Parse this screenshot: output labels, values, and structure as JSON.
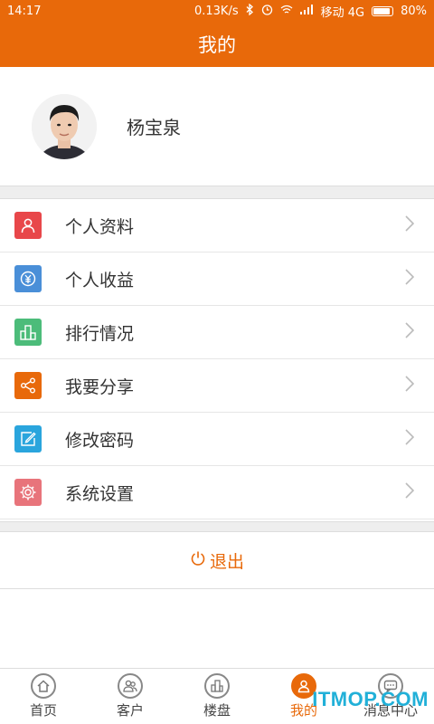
{
  "status": {
    "time": "14:17",
    "speed": "0.13K/s",
    "carrier": "移动 4G",
    "battery": "80%"
  },
  "header": {
    "title": "我的"
  },
  "profile": {
    "name": "杨宝泉"
  },
  "menu": {
    "items": [
      {
        "label": "个人资料",
        "icon": "person-icon",
        "color": "#e8474a"
      },
      {
        "label": "个人收益",
        "icon": "yuan-coin-icon",
        "color": "#4a8fd8"
      },
      {
        "label": "排行情况",
        "icon": "ranking-bars-icon",
        "color": "#4cbc7a"
      },
      {
        "label": "我要分享",
        "icon": "share-icon",
        "color": "#e8690a"
      },
      {
        "label": "修改密码",
        "icon": "edit-icon",
        "color": "#2aa5dd"
      },
      {
        "label": "系统设置",
        "icon": "gear-icon",
        "color": "#e8747b"
      }
    ]
  },
  "logout": {
    "label": "退出"
  },
  "tabs": [
    {
      "label": "首页",
      "icon": "home-icon"
    },
    {
      "label": "客户",
      "icon": "customers-icon"
    },
    {
      "label": "楼盘",
      "icon": "building-icon"
    },
    {
      "label": "我的",
      "icon": "person-icon",
      "active": true
    },
    {
      "label": "消息中心",
      "icon": "message-icon"
    }
  ],
  "watermark": "ITMOP.COM",
  "colors": {
    "brand": "#e8690a",
    "accent": "#21b0d8"
  }
}
